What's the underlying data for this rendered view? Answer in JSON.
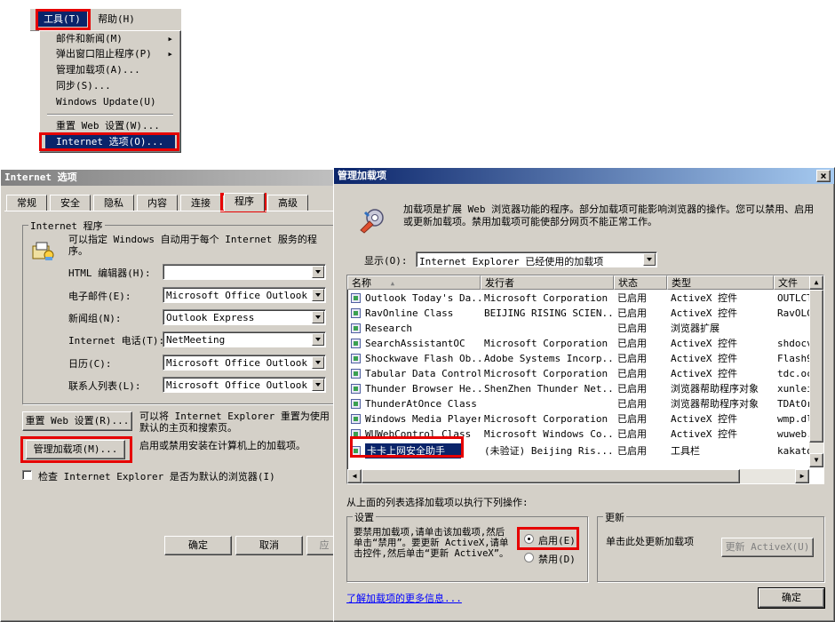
{
  "menubar": {
    "tools": "工具(T)",
    "help": "帮助(H)"
  },
  "tools_menu": {
    "items": [
      {
        "label": "邮件和新闻(M)",
        "submenu": true
      },
      {
        "label": "弹出窗口阻止程序(P)",
        "submenu": true
      },
      {
        "label": "管理加载项(A)...",
        "submenu": false
      },
      {
        "label": "同步(S)...",
        "submenu": false
      },
      {
        "label": "Windows Update(U)",
        "submenu": false
      },
      {
        "label": "重置 Web 设置(W)...",
        "submenu": false
      },
      {
        "label": "Internet 选项(O)...",
        "submenu": false,
        "selected": true
      }
    ]
  },
  "internet_options": {
    "title": "Internet 选项",
    "tabs": [
      "常规",
      "安全",
      "隐私",
      "内容",
      "连接",
      "程序",
      "高级"
    ],
    "active_tab": "程序",
    "group_label": "Internet 程序",
    "description": "可以指定 Windows 自动用于每个 Internet 服务的程序。",
    "fields": [
      {
        "label": "HTML 编辑器(H):",
        "value": ""
      },
      {
        "label": "电子邮件(E):",
        "value": "Microsoft Office Outlook"
      },
      {
        "label": "新闻组(N):",
        "value": "Outlook Express"
      },
      {
        "label": "Internet 电话(T):",
        "value": "NetMeeting"
      },
      {
        "label": "日历(C):",
        "value": "Microsoft Office Outlook"
      },
      {
        "label": "联系人列表(L):",
        "value": "Microsoft Office Outlook"
      }
    ],
    "reset_button": "重置 Web 设置(R)...",
    "reset_desc": "可以将 Internet Explorer 重置为使用默认的主页和搜索页。",
    "manage_button": "管理加载项(M)...",
    "manage_desc": "启用或禁用安装在计算机上的加载项。",
    "check_default": "检查 Internet Explorer 是否为默认的浏览器(I)",
    "ok": "确定",
    "cancel": "取消",
    "apply": "应"
  },
  "manage_addons": {
    "title": "管理加载项",
    "close": "×",
    "intro": "加载项是扩展 Web 浏览器功能的程序。部分加载项可能影响浏览器的操作。您可以禁用、启用或更新加载项。禁用加载项可能使部分网页不能正常工作。",
    "show_label": "显示(O):",
    "show_value": "Internet Explorer 已经使用的加载项",
    "columns": [
      "名称",
      "发行者",
      "状态",
      "类型",
      "文件"
    ],
    "rows": [
      {
        "name": "Outlook Today's Da...",
        "publisher": "Microsoft Corporation",
        "status": "已启用",
        "type": "ActiveX 控件",
        "file": "OUTLCT"
      },
      {
        "name": "RavOnline Class",
        "publisher": "BEIJING RISING SCIEN...",
        "status": "已启用",
        "type": "ActiveX 控件",
        "file": "RavOLC"
      },
      {
        "name": "Research",
        "publisher": "",
        "status": "已启用",
        "type": "浏览器扩展",
        "file": ""
      },
      {
        "name": "SearchAssistantOC",
        "publisher": "Microsoft Corporation",
        "status": "已启用",
        "type": "ActiveX 控件",
        "file": "shdocv"
      },
      {
        "name": "Shockwave Flash Ob...",
        "publisher": "Adobe Systems Incorp...",
        "status": "已启用",
        "type": "ActiveX 控件",
        "file": "Flash9"
      },
      {
        "name": "Tabular Data Control",
        "publisher": "Microsoft Corporation",
        "status": "已启用",
        "type": "ActiveX 控件",
        "file": "tdc.oc"
      },
      {
        "name": "Thunder Browser He...",
        "publisher": "ShenZhen Thunder Net...",
        "status": "已启用",
        "type": "浏览器帮助程序对象",
        "file": "xunlei"
      },
      {
        "name": "ThunderAtOnce Class",
        "publisher": "",
        "status": "已启用",
        "type": "浏览器帮助程序对象",
        "file": "TDAtOr"
      },
      {
        "name": "Windows Media Player",
        "publisher": "Microsoft Corporation",
        "status": "已启用",
        "type": "ActiveX 控件",
        "file": "wmp.dl"
      },
      {
        "name": "WUWebControl Class",
        "publisher": "Microsoft Windows Co...",
        "status": "已启用",
        "type": "ActiveX 控件",
        "file": "wuweb."
      },
      {
        "name": "卡卡上网安全助手",
        "publisher": "(未验证) Beijing Ris...",
        "status": "已启用",
        "type": "工具栏",
        "file": "kakato",
        "selected": true
      }
    ],
    "action_prompt": "从上面的列表选择加载项以执行下列操作:",
    "settings_label": "设置",
    "settings_desc": "要禁用加载项,请单击该加载项,然后单击“禁用”。要更新 ActiveX,请单击控件,然后单击“更新 ActiveX”。",
    "enable_label": "启用(E)",
    "disable_label": "禁用(D)",
    "update_label": "更新",
    "update_desc": "单击此处更新加载项",
    "update_button": "更新 ActiveX(U)",
    "learn_more": "了解加载项的更多信息...",
    "ok": "确定"
  },
  "colors": {
    "title_active": "#0a246a",
    "title_gradient_end": "#a6caf0",
    "title_inactive": "#808080",
    "highlight": "#0a246a",
    "red_box": "#e60000",
    "face": "#d4d0c8",
    "link": "#0000ff"
  }
}
